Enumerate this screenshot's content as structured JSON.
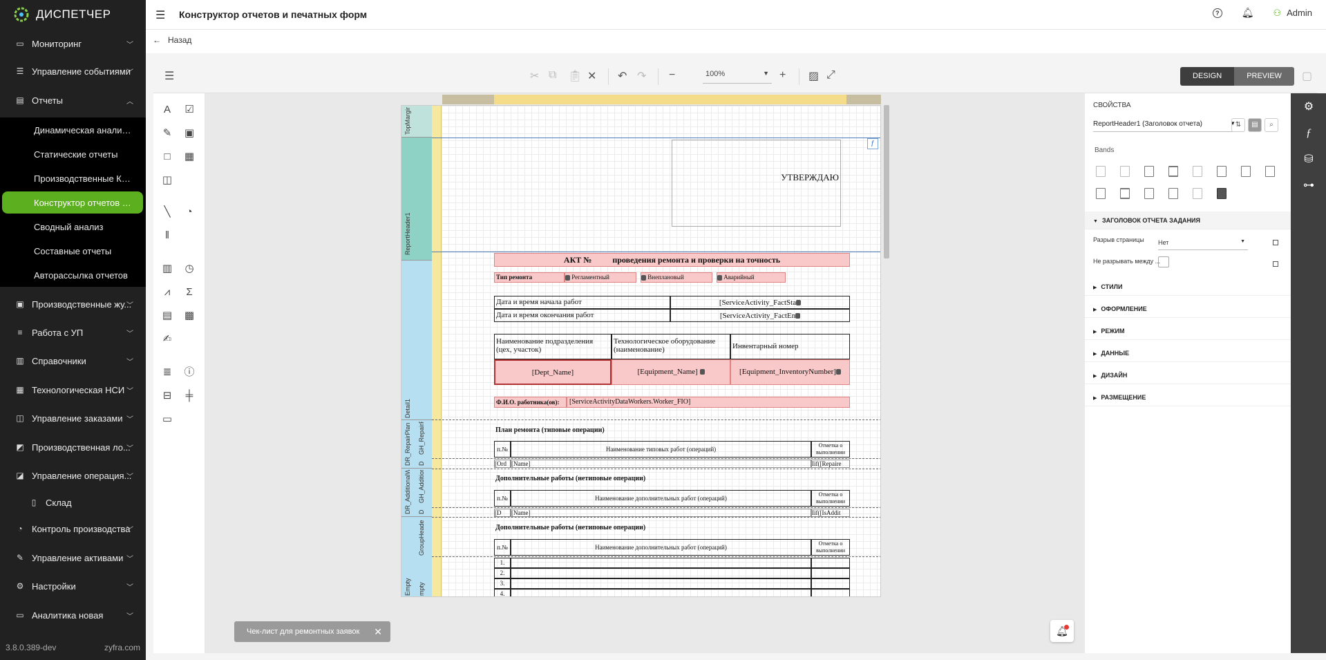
{
  "app": {
    "logo_text": "ДИСПЕТЧЕР",
    "version": "3.8.0.389-dev",
    "brand": "zyfra.com"
  },
  "sidebar": {
    "items": [
      {
        "label": "Мониторинг",
        "icon": "monitor-icon"
      },
      {
        "label": "Управление событиями",
        "icon": "events-icon"
      },
      {
        "label": "Отчеты",
        "icon": "chart-icon",
        "expanded": true
      },
      {
        "label": "Производственные жу...",
        "icon": "journal-icon"
      },
      {
        "label": "Работа с УП",
        "icon": "list-icon"
      },
      {
        "label": "Справочники",
        "icon": "book-icon"
      },
      {
        "label": "Технологическая НСИ",
        "icon": "nsi-icon"
      },
      {
        "label": "Управление заказами",
        "icon": "orders-icon"
      },
      {
        "label": "Производственная ло...",
        "icon": "logistics-icon"
      },
      {
        "label": "Управление операция...",
        "icon": "operations-icon"
      },
      {
        "label": "Склад",
        "icon": "warehouse-icon"
      },
      {
        "label": "Контроль производства",
        "icon": "control-icon"
      },
      {
        "label": "Управление активами",
        "icon": "assets-icon"
      },
      {
        "label": "Настройки",
        "icon": "settings-icon"
      },
      {
        "label": "Аналитика новая",
        "icon": "analytics-icon"
      }
    ],
    "reports_sub": [
      {
        "label": "Динамическая аналити..."
      },
      {
        "label": "Статические отчеты"
      },
      {
        "label": "Производственные КПЭ"
      },
      {
        "label": "Конструктор отчетов и ...",
        "active": true
      },
      {
        "label": "Сводный анализ"
      },
      {
        "label": "Составные отчеты"
      },
      {
        "label": "Авторассылка отчетов"
      }
    ]
  },
  "header": {
    "title": "Конструктор отчетов и печатных форм",
    "user": "Admin",
    "back_label": "Назад"
  },
  "toolbar": {
    "zoom": "100%",
    "design_label": "DESIGN",
    "preview_label": "PREVIEW"
  },
  "report": {
    "bands": [
      "TopMargin",
      "ReportHeader1",
      "Detail1",
      "DR_RepairPlan",
      "GH_RepairP",
      "D",
      "DR_AdditionalW",
      "GH_Addition",
      "D",
      "GroupHeade",
      "Empty",
      "mpty"
    ],
    "approve": "УТВЕРЖДАЮ",
    "act_title_1": "АКТ №",
    "act_title_2": "проведения ремонта и проверки на точность",
    "repair_type_label": "Тип ремонта",
    "repair_types": [
      "Регламентный",
      "Внеплановый",
      "Аварийный"
    ],
    "start_label": "Дата и время начала работ",
    "start_value": "[ServiceActivity_FactSta",
    "end_label": "Дата и время окончания работ",
    "end_value": "[ServiceActivity_FactEn",
    "col_dept": "Наименование подразделения (цех, участок)",
    "col_equipment": "Технологическое оборудование (наименование)",
    "col_inventory": "Инвентарный номер",
    "val_dept": "[Dept_Name]",
    "val_equipment": "[Equipment_Name]",
    "val_inventory": "[Equipment_InventoryNumber]",
    "workers_label": "Ф.И.О. работника(ов):",
    "workers_value": "[ServiceActivityDataWorkers.Worker_FIO]",
    "plan_title": "План ремонта (типовые операции)",
    "col_num": "п.№",
    "col_typical": "Наименование типовых работ (операций)",
    "col_mark": "Отметка о выполнении",
    "row1_num": "[Ord",
    "row1_name": "[Name]",
    "row1_mark": "Iif([Repaire",
    "add_title": "Дополнительные работы (нетиповые операции)",
    "col_additional": "Наименование дополнительных работ (операций)",
    "row2_num": "[D",
    "row2_name": "[Name]",
    "row2_mark": "Iif([IsAddit",
    "add_title_2": "Дополнительные работы (нетиповые операции)",
    "empty_rows": [
      "1.",
      "2.",
      "3.",
      "4."
    ]
  },
  "properties": {
    "title": "СВОЙСТВА",
    "selected": "ReportHeader1 (Заголовок отчета)",
    "bands_label": "Bands",
    "section_main": "ЗАГОЛОВОК ОТЧЕТА ЗАДАНИЯ",
    "page_break_label": "Разрыв страницы",
    "page_break_value": "Нет",
    "keep_label": "Не разрывать между ...",
    "sections": [
      "СТИЛИ",
      "ОФОРМЛЕНИЕ",
      "РЕЖИМ",
      "ДАННЫЕ",
      "ДИЗАЙН",
      "РАЗМЕЩЕНИЕ"
    ]
  },
  "toast": {
    "text": "Чек-лист для ремонтных заявок"
  }
}
